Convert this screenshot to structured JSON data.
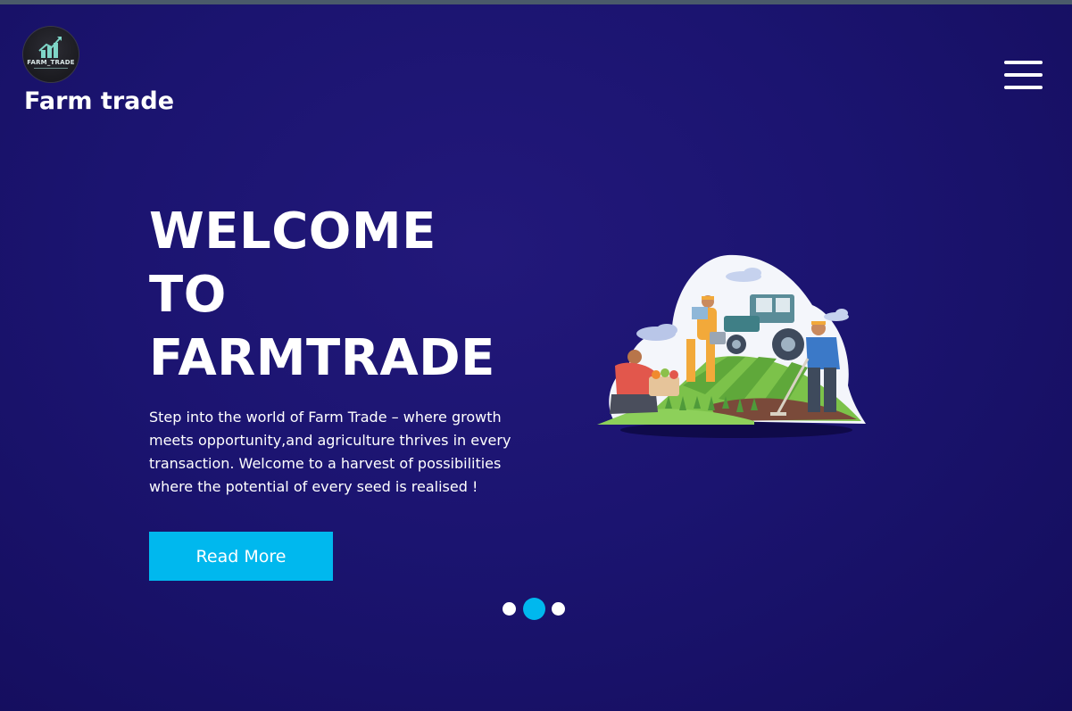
{
  "brand": {
    "logo_text": "FARM_TRADE",
    "title": "Farm trade"
  },
  "hero": {
    "title_lines": [
      "WELCOME",
      "TO",
      "FARMTRADE"
    ],
    "description": "Step into the world of Farm Trade – where growth meets opportunity,and agriculture thrives in every transaction. Welcome to a harvest of possibilities where the potential of every seed is realised !",
    "cta_label": "Read More"
  },
  "carousel": {
    "slide_count": 3,
    "active_index": 1
  },
  "icons": {
    "menu": "hamburger-menu-icon",
    "logo": "bar-chart-growth-icon",
    "illustration": "farmers-with-tractor-illustration"
  },
  "colors": {
    "background": "#1b1470",
    "accent": "#00b8ee",
    "text": "#ffffff"
  }
}
